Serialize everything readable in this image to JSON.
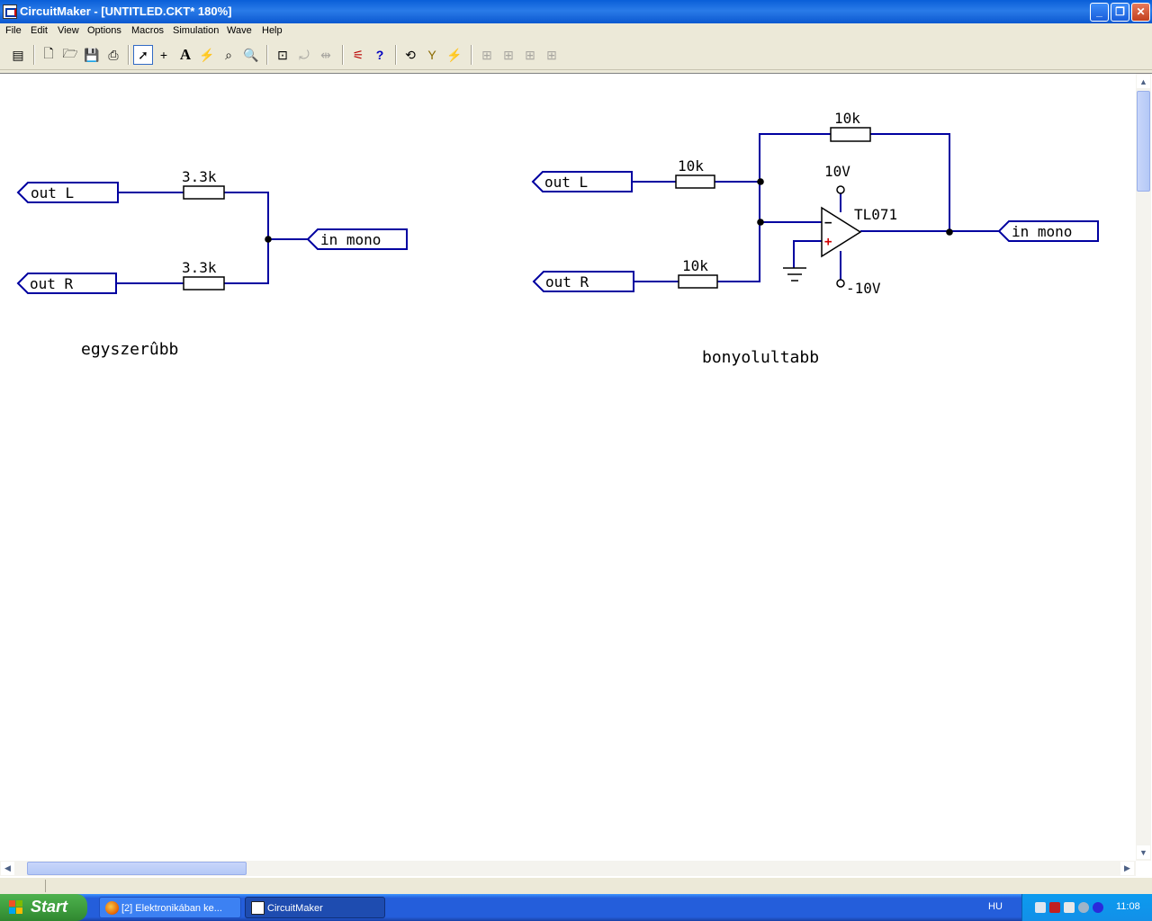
{
  "window": {
    "title": "CircuitMaker - [UNTITLED.CKT* 180%]"
  },
  "menu": [
    "File",
    "Edit",
    "View",
    "Options",
    "Macros",
    "Simulation",
    "Wave",
    "Help"
  ],
  "circuits": {
    "simple": {
      "ports": {
        "left_top": "out L",
        "left_bottom": "out R",
        "output": "in mono"
      },
      "resistors": {
        "top": "3.3k",
        "bottom": "3.3k"
      },
      "caption": "egyszerûbb"
    },
    "complex": {
      "ports": {
        "left_top": "out L",
        "left_bottom": "out R",
        "output": "in mono"
      },
      "resistors": {
        "feedback": "10k",
        "top": "10k",
        "bottom": "10k"
      },
      "opamp": {
        "model": "TL071",
        "vpos": "10V",
        "vneg": "-10V",
        "minus_sign": "−",
        "plus_sign": "+"
      },
      "caption": "bonyolultabb"
    }
  },
  "colors": {
    "wire": "#0000A0",
    "canvas": "#FFFFFF",
    "plus": "#D00000"
  },
  "taskbar": {
    "start_label": "Start",
    "tasks": [
      {
        "label": "[2] Elektronikában ke...",
        "icon": "firefox-icon"
      },
      {
        "label": "CircuitMaker",
        "icon": "circuitmaker-icon"
      }
    ],
    "language": "HU",
    "clock": "11:08"
  }
}
